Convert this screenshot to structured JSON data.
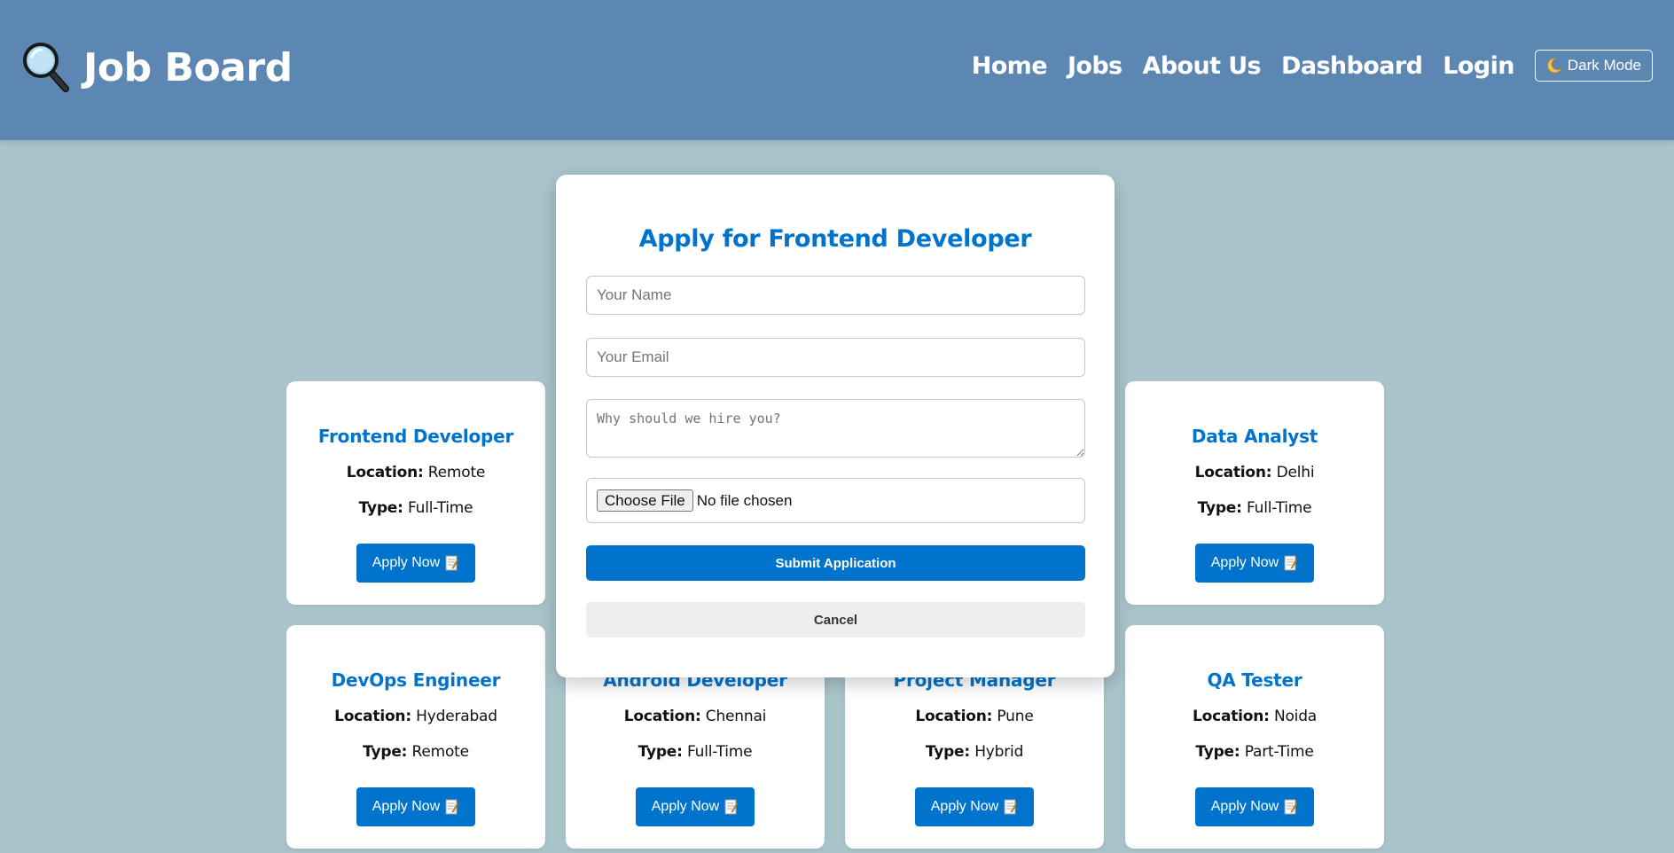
{
  "header": {
    "title": "Job Board",
    "logo_icon": "magnifying-glass-icon",
    "nav": [
      "Home",
      "Jobs",
      "About Us",
      "Dashboard",
      "Login"
    ],
    "dark_mode_label": "Dark Mode",
    "dark_mode_icon": "moon-icon",
    "background": "#5b87b2"
  },
  "jobs": [
    {
      "title": "Frontend Developer",
      "location": "Remote",
      "type": "Full-Time",
      "apply_label": "Apply Now"
    },
    {
      "title": "Android Developer",
      "location": "Chennai",
      "type": "Full-Time",
      "apply_label": "Apply Now"
    },
    {
      "title": "Project Manager",
      "location": "Pune",
      "type": "Hybrid",
      "apply_label": "Apply Now"
    },
    {
      "title": "Data Analyst",
      "location": "Delhi",
      "type": "Full-Time",
      "apply_label": "Apply Now"
    },
    {
      "title": "DevOps Engineer",
      "location": "Hyderabad",
      "type": "Remote",
      "apply_label": "Apply Now"
    },
    {
      "title": "QA Tester",
      "location": "Noida",
      "type": "Part-Time",
      "apply_label": "Apply Now"
    }
  ],
  "labels": {
    "location": "Location:",
    "type": "Type:"
  },
  "modal": {
    "title": "Apply for Frontend Developer",
    "name_placeholder": "Your Name",
    "email_placeholder": "Your Email",
    "message_placeholder": "Why should we hire you?",
    "choose_file_label": "Choose File",
    "file_status": "No file chosen",
    "submit_label": "Submit Application",
    "cancel_label": "Cancel"
  },
  "colors": {
    "accent": "#0074cc",
    "page_bg": "#a9c5cb"
  }
}
